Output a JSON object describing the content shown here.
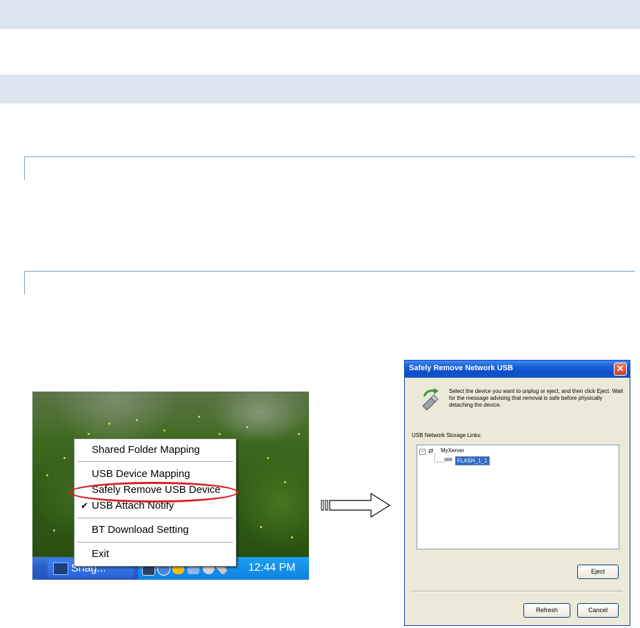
{
  "context_menu": {
    "items": [
      {
        "label": "Shared Folder Mapping",
        "checked": false
      },
      {
        "label": "USB Device Mapping",
        "checked": false
      },
      {
        "label": "Safely Remove USB Device",
        "checked": false,
        "highlighted": true
      },
      {
        "label": "USB Attach Notify",
        "checked": true
      },
      {
        "label": "BT Download Setting",
        "checked": false
      },
      {
        "label": "Exit",
        "checked": false
      }
    ],
    "check_glyph": "✔"
  },
  "taskbar": {
    "task_label": "Snag...",
    "clock": "12:44 PM"
  },
  "dialog": {
    "title": "Safely Remove Network USB",
    "close_glyph": "✕",
    "intro_text": "Select the device you want to unplug or eject, and then click Eject. Wait for the message advising that removal is safe before physically detaching the device.",
    "list_label": "USB Network Storage Links:",
    "tree": {
      "expander": "−",
      "root": "MyXerver",
      "child": "FLASH_1_1"
    },
    "buttons": {
      "eject": "Eject",
      "refresh": "Refresh",
      "cancel": "Cancel"
    }
  },
  "colors": {
    "highlight_ring": "#d71f1f",
    "titlebar": "#1a5fd8",
    "selection": "#316ac5",
    "band": "#dde6f0"
  }
}
